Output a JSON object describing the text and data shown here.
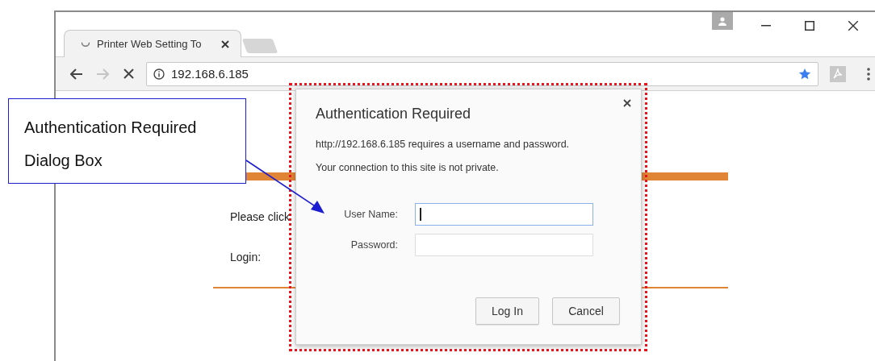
{
  "browser": {
    "tabs": [
      {
        "title": "Printer Web Setting To",
        "selected": true
      }
    ],
    "address": "192.168.6.185",
    "bookmarked": true,
    "page": {
      "texts": [
        "Please click",
        "Login:"
      ]
    }
  },
  "dialog": {
    "title": "Authentication Required",
    "message_lines": [
      "http://192.168.6.185 requires a username and password.",
      "Your connection to this site is not private."
    ],
    "fields": [
      {
        "label": "User Name:",
        "focused": true
      },
      {
        "label": "Password:",
        "focused": false
      }
    ],
    "buttons": [
      "Log In",
      "Cancel"
    ]
  },
  "annotation": {
    "text": "Authentication Required Dialog Box"
  }
}
